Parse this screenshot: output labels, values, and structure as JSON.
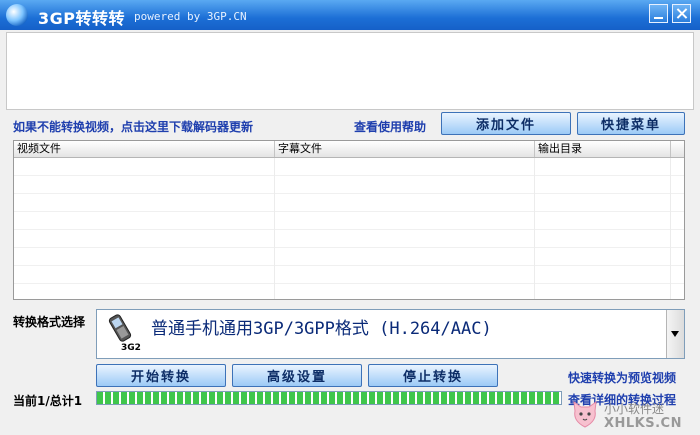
{
  "window": {
    "title": "3GP转转转",
    "subtitle": "powered by 3GP.CN"
  },
  "toolbar": {
    "decoder_link": "如果不能转换视频，点击这里下载解码器更新",
    "help_link": "查看使用帮助",
    "add_file_label": "添加文件",
    "shortcut_menu_label": "快捷菜单"
  },
  "file_list": {
    "columns": [
      "视频文件",
      "字幕文件",
      "输出目录",
      ""
    ],
    "rows": []
  },
  "format": {
    "label": "转换格式选择",
    "selected": "普通手机通用3GP/3GPP格式 (H.264/AAC)",
    "badge": "3G2",
    "icon": "mobile-phone-icon"
  },
  "actions": {
    "start_label": "开始转换",
    "advanced_label": "高级设置",
    "stop_label": "停止转换",
    "fast_preview_link": "快速转换为预览视频",
    "details_link": "查看详细的转换过程"
  },
  "status": {
    "count_text": "当前1/总计1",
    "progress_fraction": 1.0
  },
  "watermark": {
    "name": "小小软件迷",
    "domain": "XHLKS.CN"
  },
  "colors": {
    "titlebar": "#1c6fd6",
    "progress": "#3fc64b",
    "link": "#1f3fae"
  }
}
